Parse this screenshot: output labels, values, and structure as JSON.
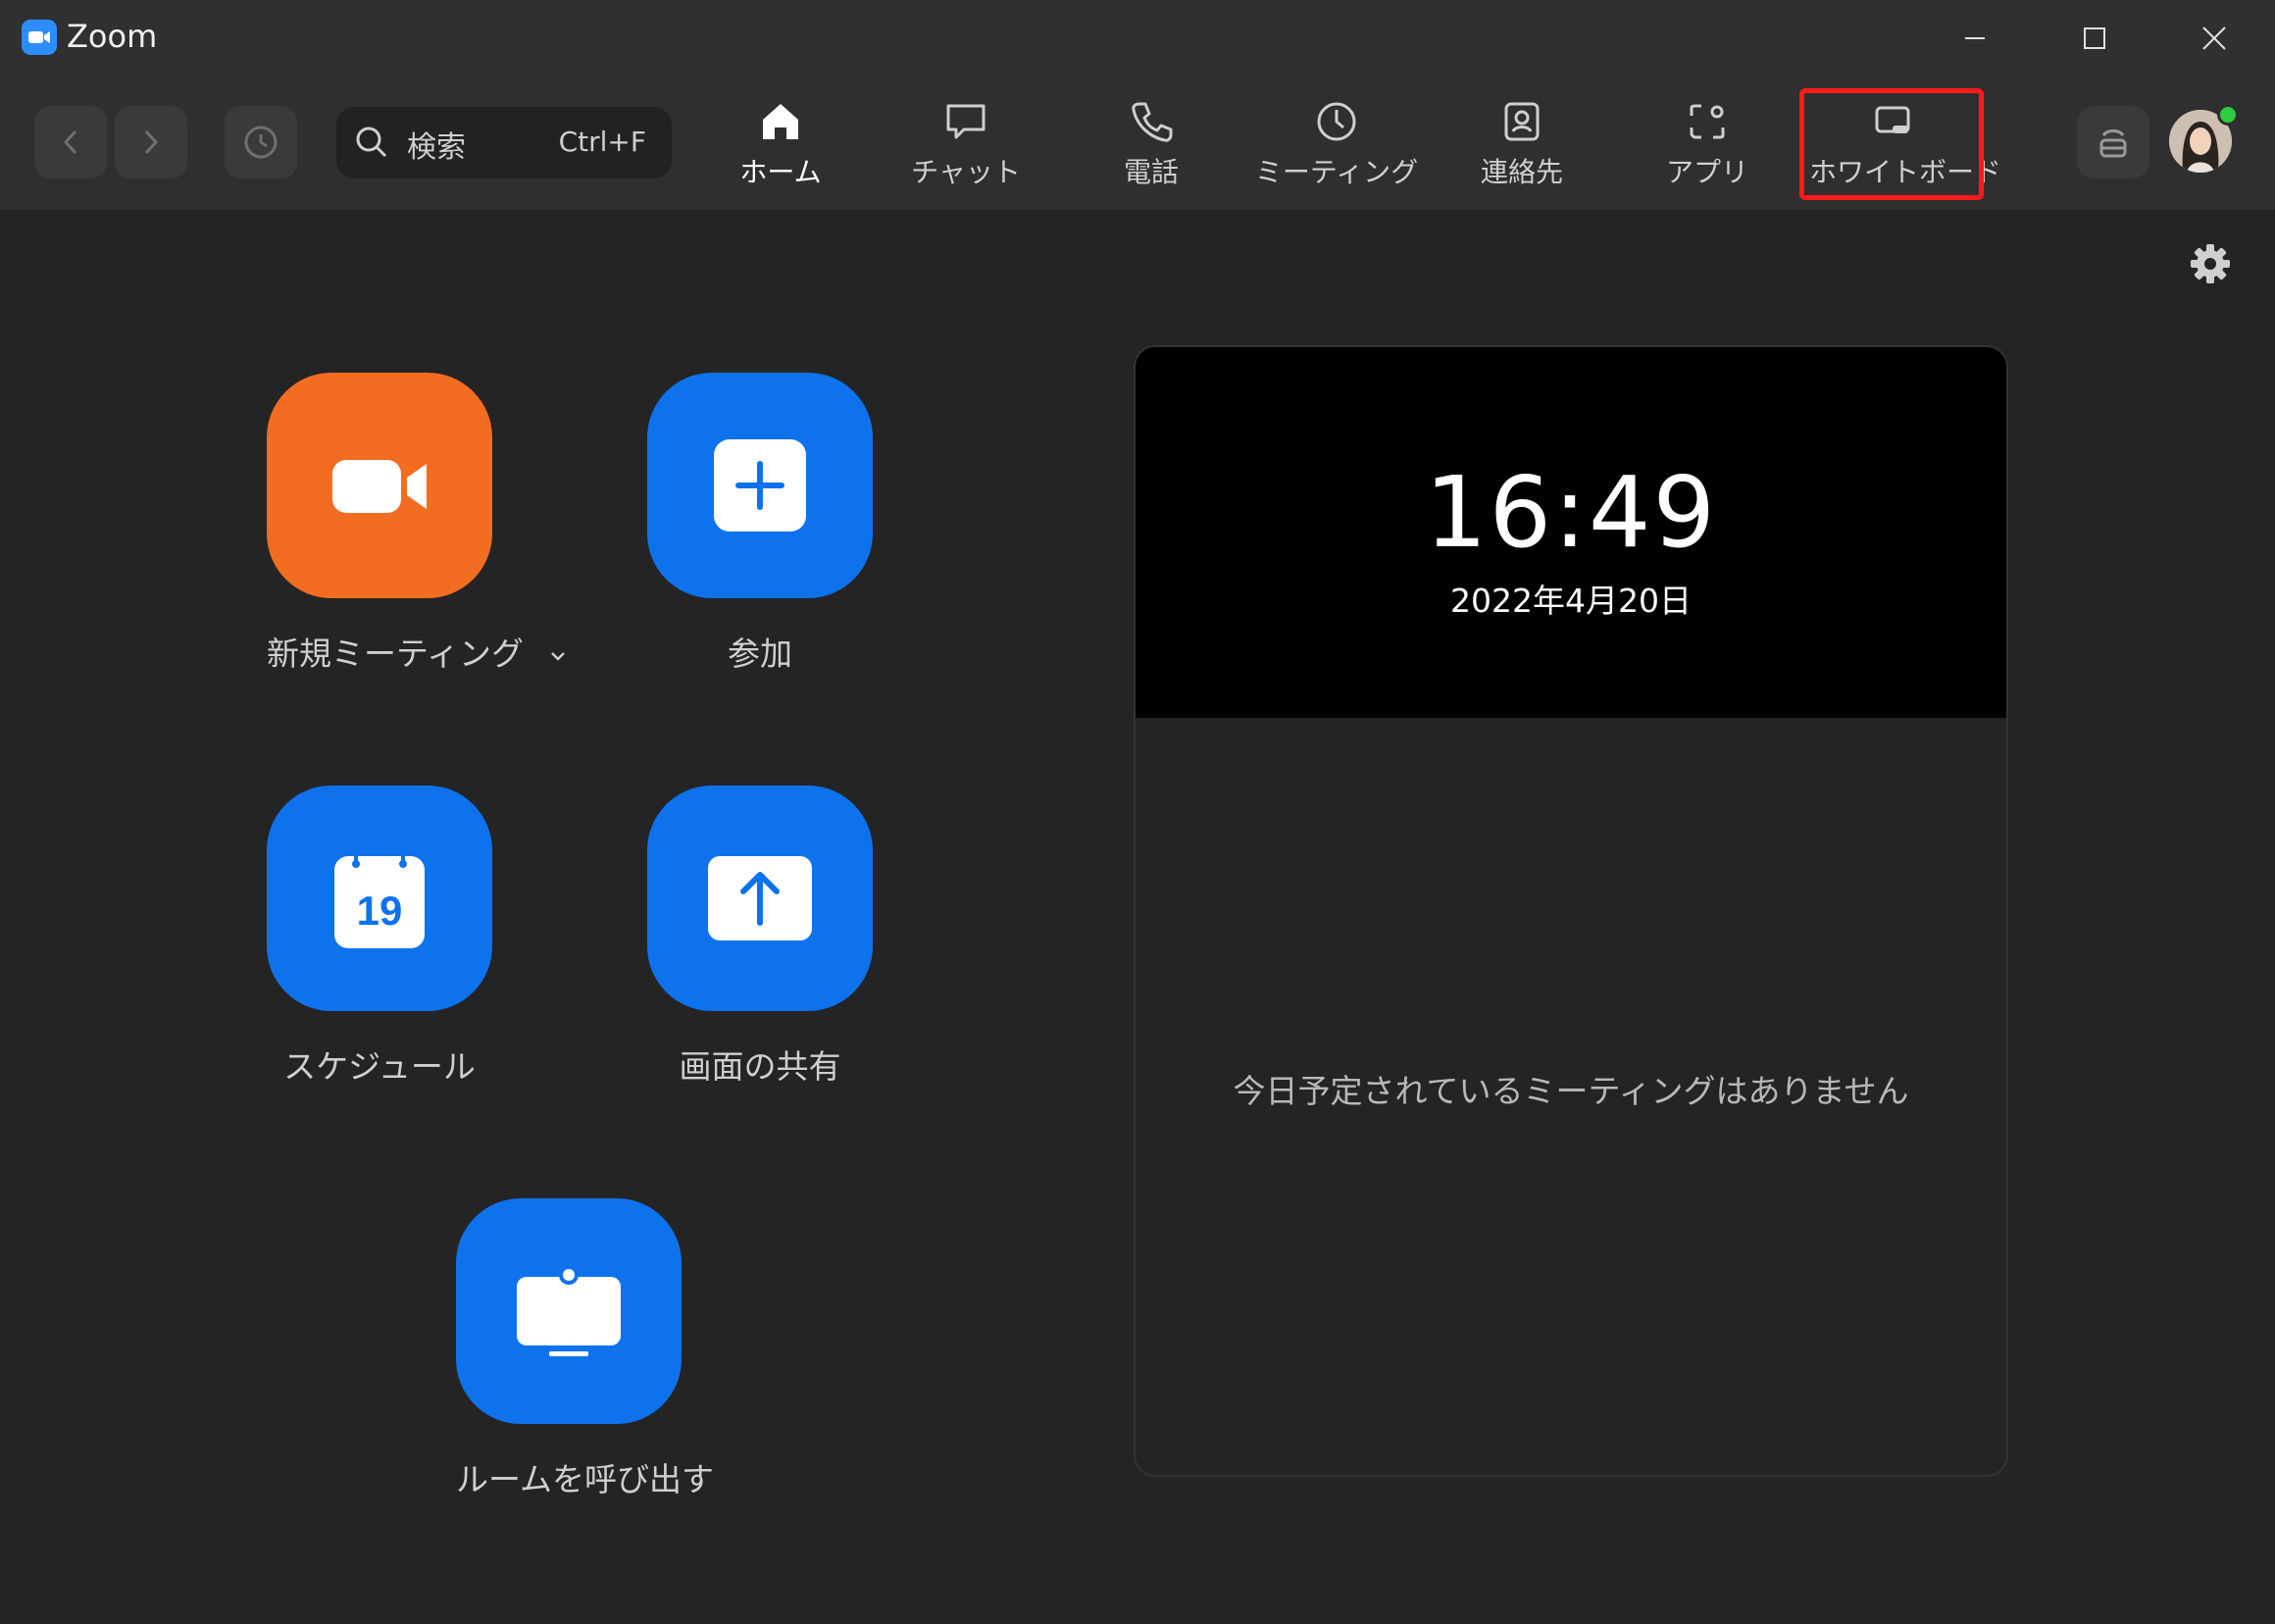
{
  "window": {
    "title": "Zoom",
    "controls": [
      "minimize-icon",
      "maximize-icon",
      "close-icon"
    ]
  },
  "nav": {
    "back_icon": "chevron-left-icon",
    "forward_icon": "chevron-right-icon",
    "history_icon": "history-icon",
    "search": {
      "placeholder": "検索",
      "shortcut": "Ctrl+F"
    },
    "tabs": [
      {
        "label": "ホーム",
        "icon": "home-icon",
        "active": true
      },
      {
        "label": "チャット",
        "icon": "chat-bubble-icon",
        "active": false
      },
      {
        "label": "電話",
        "icon": "phone-icon",
        "active": false
      },
      {
        "label": "ミーティング",
        "icon": "clock-icon",
        "active": false
      },
      {
        "label": "連絡先",
        "icon": "contact-card-icon",
        "active": false
      },
      {
        "label": "アプリ",
        "icon": "apps-icon",
        "active": false
      },
      {
        "label": "ホワイトボード",
        "icon": "whiteboard-icon",
        "active": false
      }
    ],
    "highlight_color": "#ff1a1a"
  },
  "actions": {
    "new_meeting": {
      "label": "新規ミーティング",
      "icon": "video-camera-icon",
      "color": "#f26d21"
    },
    "join": {
      "label": "参加",
      "icon": "plus-icon",
      "color": "#0e72ed"
    },
    "schedule": {
      "label": "スケジュール",
      "icon": "calendar-icon",
      "day": "19",
      "color": "#0e72ed"
    },
    "share_screen": {
      "label": "画面の共有",
      "icon": "upload-arrow-icon",
      "color": "#0e72ed"
    },
    "call_room": {
      "label": "ルームを呼び出す",
      "icon": "monitor-icon",
      "color": "#0e72ed"
    }
  },
  "panel": {
    "time": "16:49",
    "date": "2022年4月20日",
    "empty_message": "今日予定されているミーティングはありません"
  }
}
